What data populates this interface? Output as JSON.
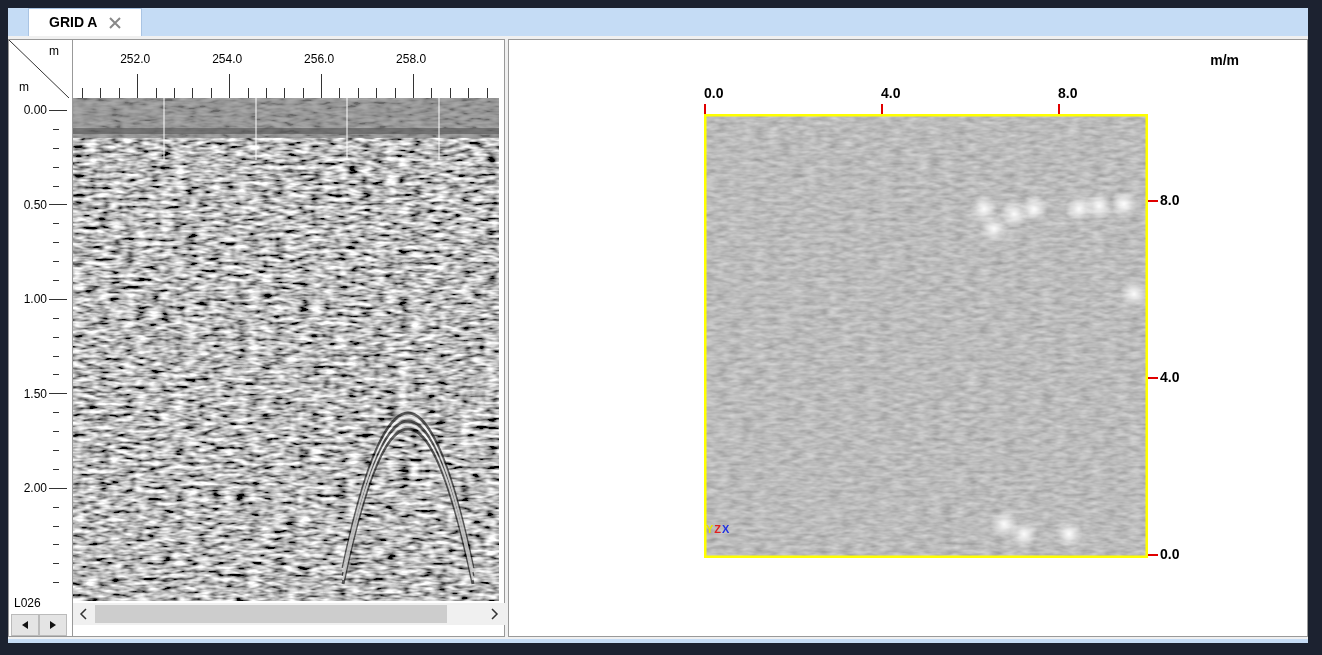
{
  "tab": {
    "label": "GRID A",
    "selected": true
  },
  "profile": {
    "corner_unit_top": "m",
    "corner_unit_left": "m",
    "distance_labels": [
      "252.0",
      "254.0",
      "256.0",
      "258.0"
    ],
    "depth_labels": [
      "0.00",
      "0.50",
      "1.00",
      "1.50",
      "2.00"
    ],
    "line_name": "L026"
  },
  "plan_view": {
    "unit": "m/m",
    "x_labels": [
      "0.0",
      "4.0",
      "8.0"
    ],
    "y_labels": [
      "8.0",
      "4.0",
      "0.0"
    ],
    "axis_letters": [
      "Y",
      "Z",
      "X"
    ]
  }
}
